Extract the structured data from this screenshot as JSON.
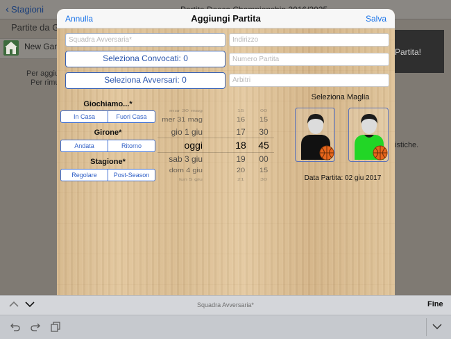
{
  "background": {
    "back_label": "Stagioni",
    "title": "Partite Desca Championship 2016/2025",
    "section_title": "Partite da Giocare",
    "new_game": "New Game",
    "tip_line1": "Per aggiungere",
    "tip_line2": "Per rimuovere",
    "panel_text": "Partita!",
    "right_text": "istiche."
  },
  "modal": {
    "cancel_label": "Annulla",
    "title": "Aggiungi Partita",
    "save_label": "Salva",
    "fields": {
      "squadra_avversaria": {
        "placeholder": "Squadra Avversaria*",
        "value": ""
      },
      "indirizzo": {
        "placeholder": "Indirizzo",
        "value": ""
      },
      "numero_partita": {
        "placeholder": "Numero Partita",
        "value": ""
      },
      "arbitri": {
        "placeholder": "Arbitri",
        "value": ""
      }
    },
    "convocati_button": "Seleziona Convocati: 0",
    "avversari_button": "Seleziona Avversari: 0",
    "giochiamo": {
      "label": "Giochiamo...*",
      "options": [
        "In Casa",
        "Fuori Casa"
      ]
    },
    "girone": {
      "label": "Girone*",
      "options": [
        "Andata",
        "Ritorno"
      ]
    },
    "stagione": {
      "label": "Stagione*",
      "options": [
        "Regolare",
        "Post-Season"
      ]
    },
    "date_picker": {
      "rows": [
        {
          "day": "mar 30 mag",
          "hour": "15",
          "minute": "00"
        },
        {
          "day": "mer 31 mag",
          "hour": "16",
          "minute": "15"
        },
        {
          "day": "gio 1 giu",
          "hour": "17",
          "minute": "30"
        },
        {
          "day": "oggi",
          "hour": "18",
          "minute": "45",
          "selected": true
        },
        {
          "day": "sab 3 giu",
          "hour": "19",
          "minute": "00"
        },
        {
          "day": "dom 4 giu",
          "hour": "20",
          "minute": "15"
        },
        {
          "day": "lun 5 giu",
          "hour": "21",
          "minute": "30"
        }
      ]
    },
    "maglia": {
      "title": "Seleziona Maglia",
      "jerseys": [
        {
          "name": "home",
          "color": "#111111"
        },
        {
          "name": "away",
          "color": "#22d626"
        }
      ]
    },
    "data_partita": "Data Partita: 02 giu 2017"
  },
  "accessory": {
    "field_name": "Squadra Avversaria*",
    "done_label": "Fine"
  },
  "colors": {
    "accent": "#1a73e8",
    "segment_blue": "#3f6fd1",
    "button_blue": "#2a55ad"
  }
}
